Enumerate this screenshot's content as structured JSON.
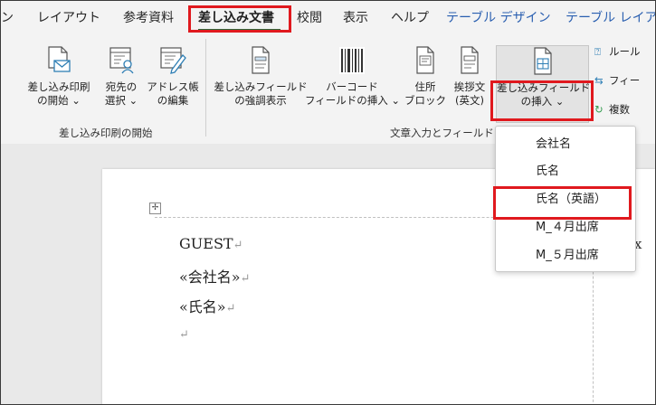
{
  "tabs": [
    {
      "label": "ン",
      "style": "normal"
    },
    {
      "label": "レイアウト",
      "style": "normal"
    },
    {
      "label": "参考資料",
      "style": "normal"
    },
    {
      "label": "差し込み文書",
      "style": "active"
    },
    {
      "label": "校閲",
      "style": "normal"
    },
    {
      "label": "表示",
      "style": "normal"
    },
    {
      "label": "ヘルプ",
      "style": "normal"
    },
    {
      "label": "テーブル デザイン",
      "style": "contextual"
    },
    {
      "label": "テーブル レイア",
      "style": "contextual"
    }
  ],
  "ribbon": {
    "start_group": {
      "label": "差し込み印刷の開始",
      "buttons": [
        {
          "line1": "差し込み印刷",
          "line2": "の開始 ⌄",
          "icon": "start-mail-merge-icon"
        },
        {
          "line1": "宛先の",
          "line2": "選択 ⌄",
          "icon": "select-recipients-icon"
        },
        {
          "line1": "アドレス帳",
          "line2": "の編集",
          "icon": "edit-address-list-icon"
        }
      ]
    },
    "write_group": {
      "label": "文章入力とフィールド",
      "buttons": [
        {
          "line1": "差し込みフィールド",
          "line2": "の強調表示",
          "icon": "highlight-fields-icon"
        },
        {
          "line1": "バーコード",
          "line2": "フィールドの挿入 ⌄",
          "icon": "barcode-icon"
        },
        {
          "line1": "住所",
          "line2": "ブロック",
          "icon": "address-block-icon"
        },
        {
          "line1": "挨拶文",
          "line2": "(英文)",
          "icon": "greeting-line-icon"
        },
        {
          "line1": "差し込みフィールド",
          "line2": "の挿入 ⌄",
          "icon": "insert-merge-field-icon"
        }
      ],
      "small_buttons": [
        {
          "label": "ルール",
          "icon": "rules-icon"
        },
        {
          "label": "フィー",
          "icon": "match-fields-icon"
        },
        {
          "label": "複数",
          "icon": "update-labels-icon"
        }
      ]
    }
  },
  "document": {
    "lines": [
      "GUEST",
      "«会社名»",
      "«氏名»",
      ""
    ],
    "trailing_text": "x",
    "pilcrow": "↵"
  },
  "dropdown": {
    "items": [
      "会社名",
      "氏名",
      "氏名（英語）",
      "M_４月出席",
      "M_５月出席"
    ],
    "highlighted_index": 2
  },
  "colors": {
    "accent_highlight": "#e0191e",
    "active_tab_underline": "#2b6a3c",
    "contextual_tab": "#2a5fb0"
  }
}
